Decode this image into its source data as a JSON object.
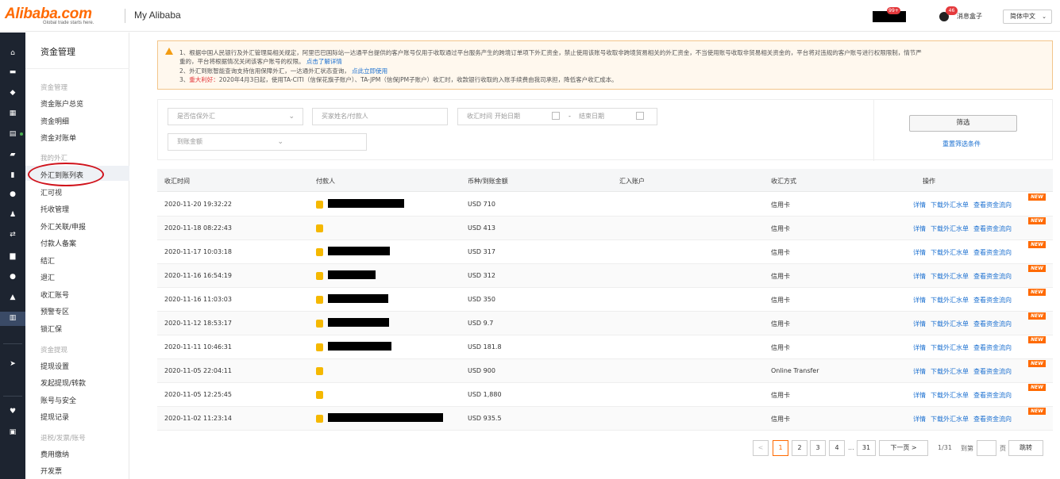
{
  "header": {
    "logo_text": "Alibaba.com",
    "logo_tagline": "Global trade starts here.",
    "app_title": "My Alibaba",
    "user_badge": "99+",
    "msg_badge": "46",
    "msg_label": "消息盒子",
    "language": "简体中文"
  },
  "sidebar": {
    "title": "资金管理",
    "groups": [
      {
        "label": "资金管理",
        "items": [
          "资金账户总览",
          "资金明细",
          "资金对账单"
        ]
      },
      {
        "label": "我的外汇",
        "items": [
          "外汇到账列表",
          "汇可视",
          "托收管理",
          "外汇关联/申报",
          "付款人备案",
          "结汇",
          "退汇",
          "收汇账号",
          "预警专区",
          "锁汇保"
        ]
      },
      {
        "label": "资金提现",
        "items": [
          "提现设置",
          "发起提现/转款",
          "账号与安全",
          "提现记录"
        ]
      },
      {
        "label": "退税/发票/账号",
        "items": [
          "费用缴纳",
          "开发票"
        ]
      }
    ]
  },
  "notice": {
    "line1": "1、根据中国人民银行及外汇管理局相关规定，阿里巴巴国际站一达通平台提供的客户账号仅用于收取通过平台服务产生的跨境订单项下外汇资金，禁止使用该账号收取非跨境贸易相关的外汇资金，不当使用账号收取非贸易相关资金的，平台将对违规的客户账号进行权限限制，情节严",
    "line2a": "重的，平台将根据情况关闭该客户账号的权限。",
    "line2b": "点击了解详情",
    "line3a": "2、外汇到账智能查询支持信用保障外汇，一达通外汇状态查询，",
    "line3b": "点此立即使用",
    "line4a": "3、",
    "line4b": "重大利好：",
    "line4c": "2020年4月3日起，使用TA-CITI（信保花旗子账户）、TA-JPM（信保JPM子账户）收汇时，收款银行收取的入账手续费由我司承担，降低客户收汇成本。"
  },
  "filters": {
    "trade_select": "是否信保外汇",
    "payer_placeholder": "买家姓名/付款人",
    "date_label": "收汇时间",
    "start_placeholder": "开始日期",
    "date_sep": "-",
    "end_placeholder": "结束日期",
    "amount_select": "到账金额",
    "filter_button": "筛选",
    "reset_link": "重置筛选条件"
  },
  "table": {
    "columns": [
      "收汇时间",
      "付款人",
      "币种/到账金额",
      "汇入账户",
      "收汇方式",
      "操作"
    ],
    "ops": [
      "详情",
      "下载外汇水单",
      "查看资金流向"
    ],
    "new_tag": "NEW",
    "rows": [
      {
        "time": "2020-11-20 19:32:22",
        "amount": "USD 710",
        "method": "信用卡",
        "redact": 96
      },
      {
        "time": "2020-11-18 08:22:43",
        "amount": "USD 413",
        "method": "信用卡",
        "redact": 0
      },
      {
        "time": "2020-11-17 10:03:18",
        "amount": "USD 317",
        "method": "信用卡",
        "redact": 78
      },
      {
        "time": "2020-11-16 16:54:19",
        "amount": "USD 312",
        "method": "信用卡",
        "redact": 60
      },
      {
        "time": "2020-11-16 11:03:03",
        "amount": "USD 350",
        "method": "信用卡",
        "redact": 76
      },
      {
        "time": "2020-11-12 18:53:17",
        "amount": "USD 9.7",
        "method": "信用卡",
        "redact": 77
      },
      {
        "time": "2020-11-11 10:46:31",
        "amount": "USD 181.8",
        "method": "信用卡",
        "redact": 80
      },
      {
        "time": "2020-11-05 22:04:11",
        "amount": "USD 900",
        "method": "Online Transfer",
        "redact": 0
      },
      {
        "time": "2020-11-05 12:25:45",
        "amount": "USD 1,880",
        "method": "信用卡",
        "redact": 0
      },
      {
        "time": "2020-11-02 11:23:14",
        "amount": "USD 935.5",
        "method": "信用卡",
        "redact": 145
      }
    ]
  },
  "pagination": {
    "prev": "<",
    "pages": [
      "1",
      "2",
      "3",
      "4"
    ],
    "ellipsis": "...",
    "last": "31",
    "next": "下一页 >",
    "summary": "1/31",
    "goto_label": "到第",
    "goto_unit": "页",
    "goto_button": "跳转"
  },
  "colors": {
    "brand": "#ff6a00",
    "link": "#1a6fd0",
    "rail": "#1d2430",
    "annotation": "#d0121b"
  }
}
